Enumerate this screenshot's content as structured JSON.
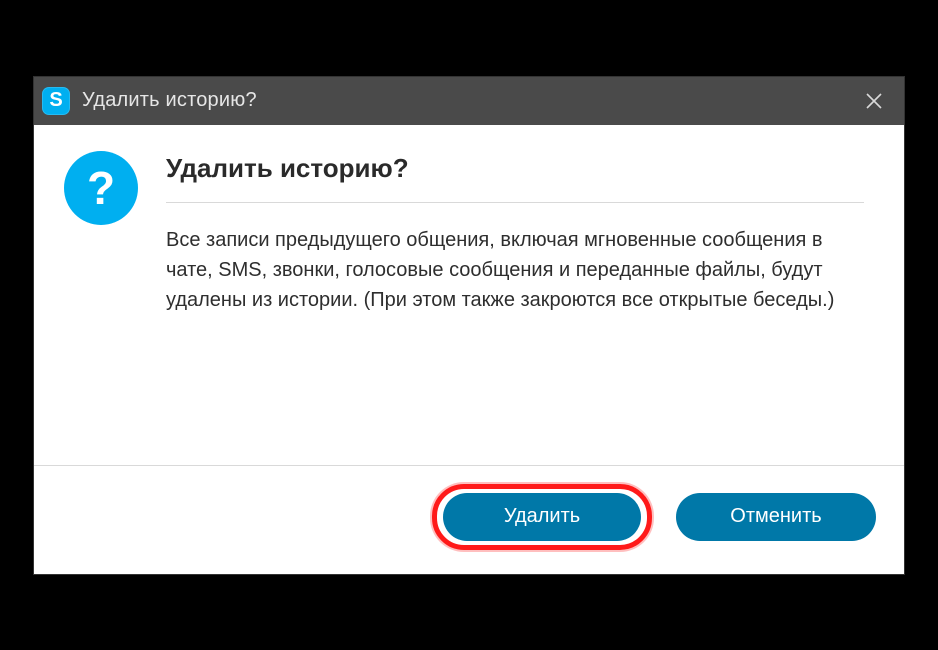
{
  "window": {
    "title": "Удалить историю?",
    "app_icon_letter": "S"
  },
  "dialog": {
    "icon_glyph": "?",
    "heading": "Удалить историю?",
    "message": "Все записи предыдущего общения, включая мгновенные сообщения в чате, SMS, звонки, голосовые сообщения и переданные файлы, будут удалены из истории. (При этом также закроются все открытые беседы.)"
  },
  "buttons": {
    "delete": "Удалить",
    "cancel": "Отменить"
  },
  "colors": {
    "accent": "#00aff0",
    "button": "#0078a8",
    "highlight": "#ff1a1a"
  }
}
